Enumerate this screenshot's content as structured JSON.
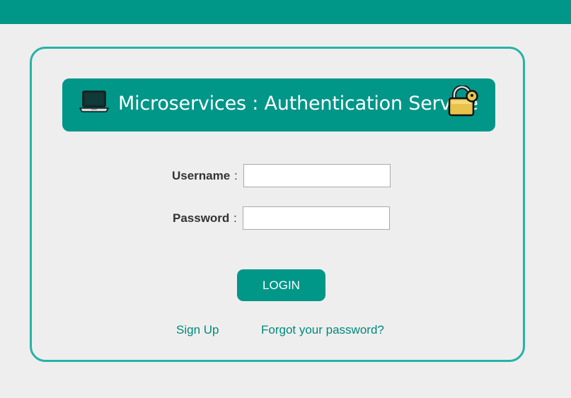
{
  "colors": {
    "primary": "#009688",
    "card_border": "#26b3a6",
    "background": "#eeeeee",
    "link": "#00897b",
    "lock_gold": "#e8c24a"
  },
  "header": {
    "title": "Microservices : Authentication Service",
    "left_icon": "laptop-icon",
    "right_icon": "lock-icon"
  },
  "form": {
    "username": {
      "label": "Username",
      "separator": ":",
      "value": "",
      "placeholder": ""
    },
    "password": {
      "label": "Password",
      "separator": ":",
      "value": "",
      "placeholder": ""
    },
    "login_label": "LOGIN"
  },
  "links": {
    "sign_up": "Sign Up",
    "forgot_password": "Forgot your password?"
  }
}
